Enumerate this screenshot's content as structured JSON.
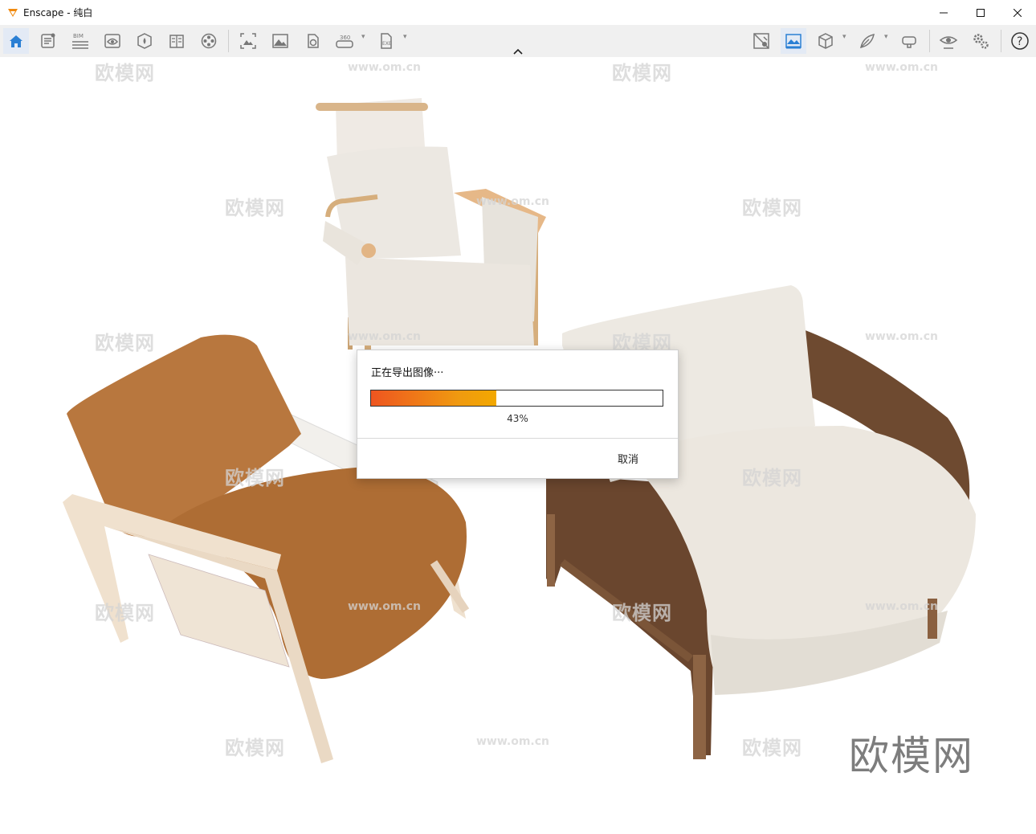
{
  "window": {
    "title": "Enscape - 纯白"
  },
  "toolbar": {
    "left": [
      {
        "icon": "home-icon"
      },
      {
        "icon": "document-icon"
      },
      {
        "icon": "bim-icon",
        "label": "BIM"
      },
      {
        "icon": "view-eye-icon"
      },
      {
        "icon": "asset-icon"
      },
      {
        "icon": "book-icon"
      },
      {
        "icon": "video-reel-icon"
      },
      {
        "icon": "screenshot-icon"
      },
      {
        "icon": "image-icon"
      },
      {
        "icon": "light-view-icon"
      },
      {
        "icon": "panorama-360-icon",
        "label": "360"
      },
      {
        "icon": "exe-export-icon",
        "label": "EXE"
      }
    ],
    "right": [
      {
        "icon": "map-icon"
      },
      {
        "icon": "batch-render-icon"
      },
      {
        "icon": "cube-icon"
      },
      {
        "icon": "feather-icon"
      },
      {
        "icon": "vr-headset-icon"
      },
      {
        "icon": "visibility-eye-icon"
      },
      {
        "icon": "settings-gears-icon"
      },
      {
        "icon": "help-icon"
      }
    ]
  },
  "watermarks": {
    "cn": "欧模网",
    "url": "www.om.cn",
    "brand": "欧模网"
  },
  "dialog": {
    "title": "正在导出图像···",
    "progress": 0.43,
    "percent_label": "43%",
    "cancel_label": "取消"
  },
  "colors": {
    "accent": "#f08010",
    "progress_start": "#ee5520",
    "progress_end": "#f2a800"
  }
}
